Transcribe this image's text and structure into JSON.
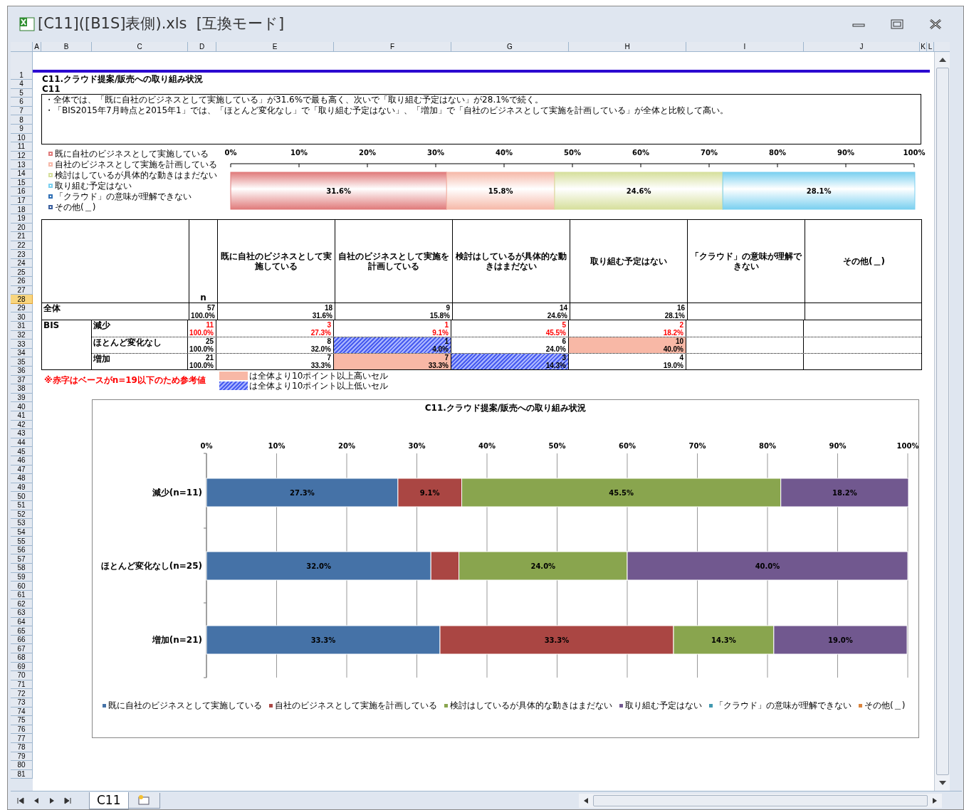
{
  "window": {
    "title": "[C11]([B1S]表側).xls  [互換モード]"
  },
  "column_headers": [
    {
      "label": "A",
      "selected": false
    },
    {
      "label": "B",
      "selected": false
    },
    {
      "label": "C",
      "selected": false
    },
    {
      "label": "D",
      "selected": false
    },
    {
      "label": "E",
      "selected": false
    },
    {
      "label": "F",
      "selected": false
    },
    {
      "label": "G",
      "selected": false
    },
    {
      "label": "H",
      "selected": false
    },
    {
      "label": "I",
      "selected": false
    },
    {
      "label": "J",
      "selected": false
    },
    {
      "label": "K",
      "selected": false
    },
    {
      "label": "L",
      "selected": false
    }
  ],
  "row_headers": [
    {
      "label": "1",
      "selected": false
    },
    {
      "label": "4",
      "selected": false
    },
    {
      "label": "5",
      "selected": false
    },
    {
      "label": "6",
      "selected": false
    },
    {
      "label": "7",
      "selected": false
    },
    {
      "label": "8",
      "selected": false
    },
    {
      "label": "9",
      "selected": false
    },
    {
      "label": "10",
      "selected": false
    },
    {
      "label": "11",
      "selected": false
    },
    {
      "label": "12",
      "selected": false
    },
    {
      "label": "13",
      "selected": false
    },
    {
      "label": "14",
      "selected": false
    },
    {
      "label": "15",
      "selected": false
    },
    {
      "label": "16",
      "selected": false
    },
    {
      "label": "17",
      "selected": false
    },
    {
      "label": "18",
      "selected": false
    },
    {
      "label": "19",
      "selected": false
    },
    {
      "label": "20",
      "selected": false
    },
    {
      "label": "21",
      "selected": false
    },
    {
      "label": "22",
      "selected": false
    },
    {
      "label": "23",
      "selected": false
    },
    {
      "label": "24",
      "selected": false
    },
    {
      "label": "25",
      "selected": false
    },
    {
      "label": "26",
      "selected": false
    },
    {
      "label": "27",
      "selected": false
    },
    {
      "label": "28",
      "selected": true
    },
    {
      "label": "29",
      "selected": false
    },
    {
      "label": "30",
      "selected": false
    },
    {
      "label": "31",
      "selected": false
    },
    {
      "label": "32",
      "selected": false
    },
    {
      "label": "33",
      "selected": false
    },
    {
      "label": "34",
      "selected": false
    },
    {
      "label": "35",
      "selected": false
    },
    {
      "label": "36",
      "selected": false
    },
    {
      "label": "37",
      "selected": false
    },
    {
      "label": "38",
      "selected": false
    },
    {
      "label": "39",
      "selected": false
    },
    {
      "label": "40",
      "selected": false
    },
    {
      "label": "41",
      "selected": false
    },
    {
      "label": "42",
      "selected": false
    },
    {
      "label": "43",
      "selected": false
    },
    {
      "label": "44",
      "selected": false
    },
    {
      "label": "45",
      "selected": false
    },
    {
      "label": "46",
      "selected": false
    },
    {
      "label": "47",
      "selected": false
    },
    {
      "label": "48",
      "selected": false
    },
    {
      "label": "49",
      "selected": false
    },
    {
      "label": "50",
      "selected": false
    },
    {
      "label": "51",
      "selected": false
    },
    {
      "label": "52",
      "selected": false
    },
    {
      "label": "53",
      "selected": false
    },
    {
      "label": "54",
      "selected": false
    },
    {
      "label": "55",
      "selected": false
    },
    {
      "label": "56",
      "selected": false
    },
    {
      "label": "57",
      "selected": false
    },
    {
      "label": "58",
      "selected": false
    },
    {
      "label": "59",
      "selected": false
    },
    {
      "label": "60",
      "selected": false
    },
    {
      "label": "61",
      "selected": false
    },
    {
      "label": "62",
      "selected": false
    },
    {
      "label": "63",
      "selected": false
    },
    {
      "label": "64",
      "selected": false
    },
    {
      "label": "65",
      "selected": false
    },
    {
      "label": "66",
      "selected": false
    },
    {
      "label": "67",
      "selected": false
    },
    {
      "label": "68",
      "selected": false
    },
    {
      "label": "69",
      "selected": false
    },
    {
      "label": "70",
      "selected": false
    },
    {
      "label": "71",
      "selected": false
    },
    {
      "label": "72",
      "selected": false
    },
    {
      "label": "73",
      "selected": false
    },
    {
      "label": "74",
      "selected": false
    },
    {
      "label": "75",
      "selected": false
    },
    {
      "label": "76",
      "selected": false
    },
    {
      "label": "77",
      "selected": false
    },
    {
      "label": "78",
      "selected": false
    },
    {
      "label": "79",
      "selected": false
    },
    {
      "label": "80",
      "selected": false
    },
    {
      "label": "81",
      "selected": false
    }
  ],
  "sheet": {
    "title": "C11.クラウド提案/販売への取り組み状況",
    "subtitle": "C11",
    "summary": [
      "・全体では、「既に自社のビジネスとして実施している」が31.6%で最も高く、次いで「取り組む予定はない」が28.1%で続く。",
      "・「BIS2015年7月時点と2015年1」では、「ほとんど変化なし」で「取り組む予定はない」、「増加」で「自社のビジネスとして実施を計画している」が全体と比較して高い。"
    ],
    "top_chart": {
      "chart_data": {
        "type": "bar",
        "orientation": "horizontal",
        "stacked": true,
        "series": [
          {
            "name": "既に自社のビジネスとして実施している",
            "color": "#e07b7b",
            "values": [
              31.6
            ]
          },
          {
            "name": "自社のビジネスとして実施を計画している",
            "color": "#f6b9a9",
            "values": [
              15.8
            ]
          },
          {
            "name": "検討はしているが具体的な動きはまだない",
            "color": "#d6df9c",
            "values": [
              24.6
            ]
          },
          {
            "name": "取り組む予定はない",
            "color": "#7ad0f0",
            "values": [
              28.1
            ]
          },
          {
            "name": "「クラウド」の意味が理解できない",
            "color": "#2f6fb5",
            "values": [
              0
            ]
          },
          {
            "name": "その他(＿)",
            "color": "#3b5f9e",
            "values": [
              0
            ]
          }
        ],
        "xlim": [
          0,
          100
        ],
        "xticks": [
          {
            "value": 0,
            "label": "0%"
          },
          {
            "value": 10,
            "label": "10%"
          },
          {
            "value": 20,
            "label": "20%"
          },
          {
            "value": 30,
            "label": "30%"
          },
          {
            "value": 40,
            "label": "40%"
          },
          {
            "value": 50,
            "label": "50%"
          },
          {
            "value": 60,
            "label": "60%"
          },
          {
            "value": 70,
            "label": "70%"
          },
          {
            "value": 80,
            "label": "80%"
          },
          {
            "value": 90,
            "label": "90%"
          },
          {
            "value": 100,
            "label": "100%"
          }
        ],
        "value_labels": [
          [
            "31.6%"
          ],
          [
            "15.8%"
          ],
          [
            "24.6%"
          ],
          [
            "28.1%"
          ],
          [
            null
          ],
          [
            null
          ]
        ],
        "legend": "left"
      }
    },
    "table": {
      "columns": [
        {
          "label": "n"
        },
        {
          "label": "既に自社のビジネスとして実施している"
        },
        {
          "label": "自社のビジネスとして実施を計画している"
        },
        {
          "label": "検討はしているが具体的な動きはまだない"
        },
        {
          "label": "取り組む予定はない"
        },
        {
          "label": "「クラウド」の意味が理解できない"
        },
        {
          "label": "その他(＿)"
        }
      ],
      "total": {
        "label": "全体",
        "n": "57",
        "n_pct": "100.0%",
        "cells": [
          {
            "count": "18",
            "pct": "31.6%",
            "above_total": false,
            "below_total": false
          },
          {
            "count": "9",
            "pct": "15.8%",
            "above_total": false,
            "below_total": false
          },
          {
            "count": "14",
            "pct": "24.6%",
            "above_total": false,
            "below_total": false
          },
          {
            "count": "16",
            "pct": "28.1%",
            "above_total": false,
            "below_total": false
          }
        ]
      },
      "groups": [
        {
          "label": "BIS",
          "rows": [
            {
              "label": "減少",
              "small_base": true,
              "n": "11",
              "n_pct": "100.0%",
              "cells": [
                {
                  "count": "3",
                  "pct": "27.3%",
                  "above_total": false,
                  "below_total": false
                },
                {
                  "count": "1",
                  "pct": "9.1%",
                  "above_total": false,
                  "below_total": false
                },
                {
                  "count": "5",
                  "pct": "45.5%",
                  "above_total": false,
                  "below_total": false
                },
                {
                  "count": "2",
                  "pct": "18.2%",
                  "above_total": false,
                  "below_total": false
                }
              ]
            },
            {
              "label": "ほとんど変化なし",
              "small_base": false,
              "n": "25",
              "n_pct": "100.0%",
              "cells": [
                {
                  "count": "8",
                  "pct": "32.0%",
                  "above_total": false,
                  "below_total": false
                },
                {
                  "count": "1",
                  "pct": "4.0%",
                  "above_total": false,
                  "below_total": true
                },
                {
                  "count": "6",
                  "pct": "24.0%",
                  "above_total": false,
                  "below_total": false
                },
                {
                  "count": "10",
                  "pct": "40.0%",
                  "above_total": true,
                  "below_total": false
                }
              ]
            },
            {
              "label": "増加",
              "small_base": false,
              "n": "21",
              "n_pct": "100.0%",
              "cells": [
                {
                  "count": "7",
                  "pct": "33.3%",
                  "above_total": false,
                  "below_total": false
                },
                {
                  "count": "7",
                  "pct": "33.3%",
                  "above_total": true,
                  "below_total": false
                },
                {
                  "count": "3",
                  "pct": "14.3%",
                  "above_total": false,
                  "below_total": true
                },
                {
                  "count": "4",
                  "pct": "19.0%",
                  "above_total": false,
                  "below_total": false
                }
              ]
            }
          ]
        }
      ]
    },
    "notes": {
      "small_base": "※赤字はベースがn=19以下のため参考値",
      "high": "は全体より10ポイント以上高いセル",
      "low": "は全体より10ポイント以上低いセル"
    },
    "chart": {
      "chart_data": {
        "type": "bar",
        "orientation": "horizontal",
        "stacked": true,
        "title": "C11.クラウド提案/販売への取り組み状況",
        "categories": [
          "減少(n=11)",
          "ほとんど変化なし(n=25)",
          "増加(n=21)"
        ],
        "series": [
          {
            "name": "既に自社のビジネスとして実施している",
            "color": "#4572a7",
            "values": [
              27.3,
              32.0,
              33.3
            ]
          },
          {
            "name": "自社のビジネスとして実施を計画している",
            "color": "#aa4643",
            "values": [
              9.1,
              4.0,
              33.3
            ]
          },
          {
            "name": "検討はしているが具体的な動きはまだない",
            "color": "#89a54e",
            "values": [
              45.5,
              24.0,
              14.3
            ]
          },
          {
            "name": "取り組む予定はない",
            "color": "#71588f",
            "values": [
              18.2,
              40.0,
              19.0
            ]
          },
          {
            "name": "「クラウド」の意味が理解できない",
            "color": "#4198af",
            "values": [
              0,
              0,
              0
            ]
          },
          {
            "name": "その他(＿)",
            "color": "#db843d",
            "values": [
              0,
              0,
              0
            ]
          }
        ],
        "xlim": [
          0,
          100
        ],
        "xticks": [
          {
            "value": 0,
            "label": "0%"
          },
          {
            "value": 10,
            "label": "10%"
          },
          {
            "value": 20,
            "label": "20%"
          },
          {
            "value": 30,
            "label": "30%"
          },
          {
            "value": 40,
            "label": "40%"
          },
          {
            "value": 50,
            "label": "50%"
          },
          {
            "value": 60,
            "label": "60%"
          },
          {
            "value": 70,
            "label": "70%"
          },
          {
            "value": 80,
            "label": "80%"
          },
          {
            "value": 90,
            "label": "90%"
          },
          {
            "value": 100,
            "label": "100%"
          }
        ],
        "value_labels": [
          [
            "27.3%",
            "32.0%",
            "33.3%"
          ],
          [
            "9.1%",
            null,
            "33.3%"
          ],
          [
            "45.5%",
            "24.0%",
            "14.3%"
          ],
          [
            "18.2%",
            "40.0%",
            "19.0%"
          ],
          [
            null,
            null,
            null
          ],
          [
            null,
            null,
            null
          ]
        ],
        "grid": true,
        "legend": "bottom"
      }
    }
  },
  "sheet_tabs": [
    {
      "label": "C11",
      "selected": true
    }
  ]
}
